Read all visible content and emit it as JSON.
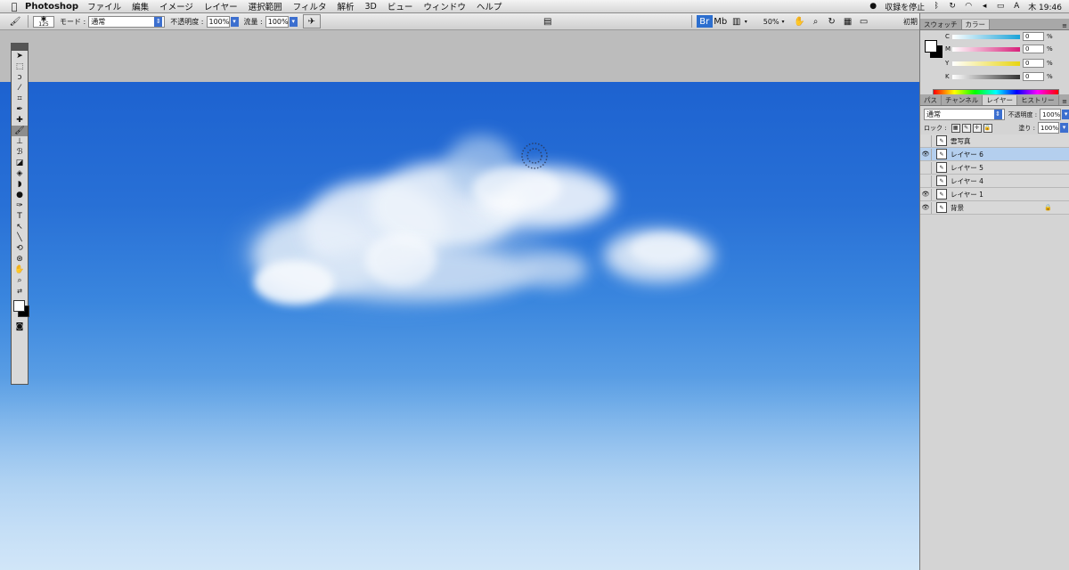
{
  "menubar": {
    "app_name": "Photoshop",
    "items": [
      "ファイル",
      "編集",
      "イメージ",
      "レイヤー",
      "選択範囲",
      "フィルタ",
      "解析",
      "3D",
      "ビュー",
      "ウィンドウ",
      "ヘルプ"
    ],
    "status_text": "収録を停止",
    "clock": "木 19:46"
  },
  "options": {
    "brush_size": "125",
    "mode_label": "モード :",
    "mode_value": "通常",
    "opacity_label": "不透明度 :",
    "opacity_value": "100%",
    "flow_label": "流量 :",
    "flow_value": "100%",
    "zoom_value": "50%",
    "workspace_label": "初期"
  },
  "color_panel": {
    "tabs": [
      "スウォッチ",
      "カラー"
    ],
    "channels": [
      {
        "label": "C",
        "value": "0",
        "unit": "%",
        "color": "#1aa3d8"
      },
      {
        "label": "M",
        "value": "0",
        "unit": "%",
        "color": "#d8207a"
      },
      {
        "label": "Y",
        "value": "0",
        "unit": "%",
        "color": "#e8d410"
      },
      {
        "label": "K",
        "value": "0",
        "unit": "%",
        "color": "#333333"
      }
    ]
  },
  "layers_panel": {
    "tabs": [
      "パス",
      "チャンネル",
      "レイヤー",
      "ヒストリー"
    ],
    "blend_mode": "通常",
    "opacity_label": "不透明度 :",
    "opacity_value": "100%",
    "lock_label": "ロック :",
    "fill_label": "塗り :",
    "fill_value": "100%",
    "layers": [
      {
        "name": "雲写真",
        "visible": false,
        "active": false,
        "locked": false
      },
      {
        "name": "レイヤー 6",
        "visible": true,
        "active": true,
        "locked": false
      },
      {
        "name": "レイヤー 5",
        "visible": false,
        "active": false,
        "locked": false
      },
      {
        "name": "レイヤー 4",
        "visible": false,
        "active": false,
        "locked": false
      },
      {
        "name": "レイヤー 1",
        "visible": true,
        "active": false,
        "locked": false
      },
      {
        "name": "背景",
        "visible": true,
        "active": false,
        "locked": true
      }
    ]
  },
  "tools": [
    "move-tool",
    "marquee-tool",
    "lasso-tool",
    "magic-wand-tool",
    "crop-tool",
    "eyedropper-tool",
    "spot-heal-tool",
    "brush-tool",
    "clone-stamp-tool",
    "history-brush-tool",
    "eraser-tool",
    "paint-bucket-tool",
    "blur-tool",
    "dodge-tool",
    "pen-tool",
    "type-tool",
    "path-select-tool",
    "line-tool",
    "3d-rotate-tool",
    "3d-orbit-tool",
    "hand-tool",
    "zoom-tool"
  ],
  "active_tool": "brush-tool"
}
